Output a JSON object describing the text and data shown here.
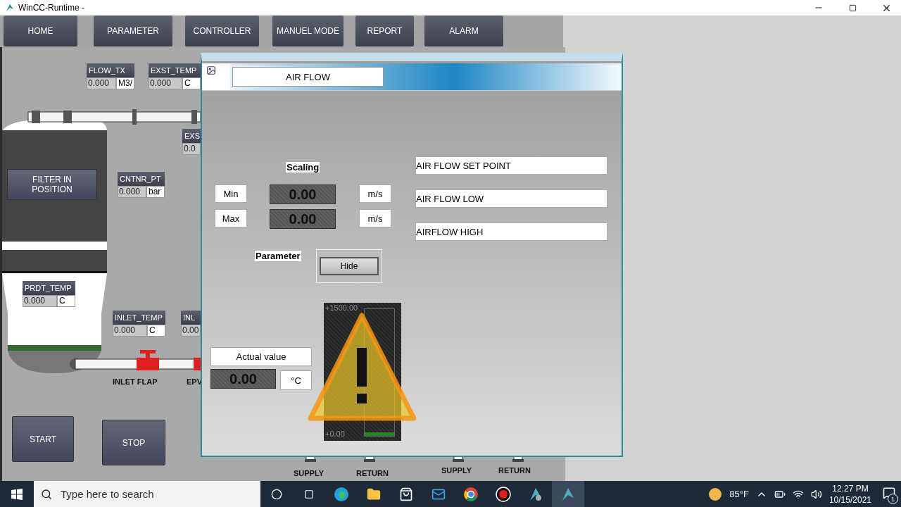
{
  "window": {
    "title": "WinCC-Runtime -"
  },
  "nav": [
    {
      "label": "HOME"
    },
    {
      "label": "PARAMETER"
    },
    {
      "label": "CONTROLLER"
    },
    {
      "label": "MANUEL MODE"
    },
    {
      "label": "REPORT"
    },
    {
      "label": "ALARM"
    }
  ],
  "tags": [
    {
      "name": "FLOW_TX",
      "value": "0.000",
      "unit": "M3/"
    },
    {
      "name": "EXST_TEMP",
      "value": "0.000",
      "unit": "C"
    },
    {
      "name": "EXS",
      "value": "0.0"
    },
    {
      "name": "CNTNR_PT",
      "value": "0.000",
      "unit": "bar"
    },
    {
      "name": "PRDT_TEMP",
      "value": "0.000",
      "unit": "C"
    },
    {
      "name": "INLET_TEMP",
      "value": "0.000",
      "unit": "C"
    },
    {
      "name": "INL",
      "value": "0.00"
    }
  ],
  "buttons": [
    {
      "label": "FILTER IN POSITION"
    },
    {
      "label": "START"
    },
    {
      "label": "STOP"
    }
  ],
  "labels": [
    "INLET FLAP",
    "EPV",
    "SUPPLY",
    "RETURN",
    "SUPPLY",
    "RETURN"
  ],
  "popup": {
    "title": "AIR FLOW",
    "scaling": "Scaling",
    "rows": [
      {
        "label": "Min",
        "value": "0.00",
        "unit": "m/s"
      },
      {
        "label": "Max",
        "value": "0.00",
        "unit": "m/s"
      }
    ],
    "parameter": "Parameter",
    "hide_button": "Hide",
    "limits": [
      "AIR FLOW SET POINT",
      "AIR FLOW LOW",
      "AIRFLOW HIGH"
    ],
    "actual_label": "Actual value",
    "actual_value": "0.00",
    "actual_unit": "°C",
    "bar": {
      "level": 0.03,
      "scale_top": "+1500.00",
      "scale_bottom": "+0.00"
    },
    "alarm": true
  },
  "taskbar": {
    "search": {
      "placeholder": "Type here to search"
    },
    "weather": "85°F",
    "time": "12:27 PM",
    "date": "10/15/2021",
    "notifications": "1"
  }
}
